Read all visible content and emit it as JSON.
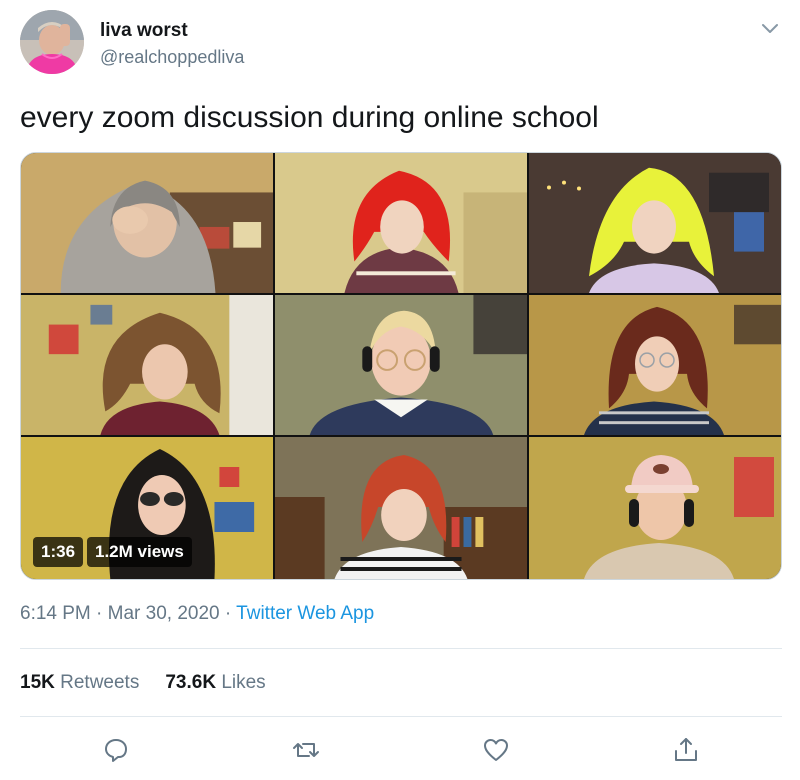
{
  "author": {
    "name": "liva worst",
    "handle": "@realchoppedliva",
    "avatar_icon": "profile-photo"
  },
  "tweet": {
    "text": "every zoom discussion during online school"
  },
  "video": {
    "duration": "1:36",
    "views": "1.2M views",
    "layout": "3x3 zoom call grid"
  },
  "meta": {
    "time": "6:14 PM",
    "separator1": " · ",
    "date": "Mar 30, 2020",
    "separator2": " · ",
    "source": "Twitter Web App"
  },
  "stats": {
    "retweets_count": "15K",
    "retweets_label": " Retweets",
    "likes_count": "73.6K",
    "likes_label": " Likes"
  },
  "actions": {
    "icons": [
      "reply-icon",
      "retweet-icon",
      "like-icon",
      "share-icon"
    ]
  },
  "colors": {
    "link_blue": "#1b95e0",
    "secondary_text": "#657786",
    "primary_text": "#14171a",
    "divider": "#e1e8ed"
  }
}
